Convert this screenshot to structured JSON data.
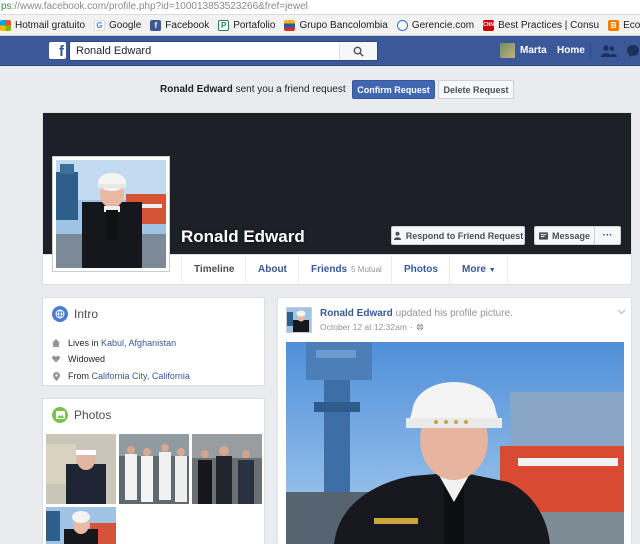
{
  "browser": {
    "url_scheme": "ps",
    "url_rest": "://www.facebook.com/profile.php?id=100013853523266&fref=jewel",
    "bookmarks": [
      {
        "label": "Hotmail gratuito",
        "icon": "windows-icon",
        "color": "#e94e2f"
      },
      {
        "label": "Google",
        "icon": "google-icon",
        "color": "#4285f4"
      },
      {
        "label": "Facebook",
        "icon": "facebook-icon",
        "color": "#3b5998"
      },
      {
        "label": "Portafolio",
        "icon": "p-icon",
        "color": "#2c7a5a"
      },
      {
        "label": "Grupo Bancolombia",
        "icon": "bancolombia-icon",
        "color": "#f2b50f"
      },
      {
        "label": "Gerencie.com",
        "icon": "gerencie-icon",
        "color": "#2a72c9"
      },
      {
        "label": "Best Practices | Consu",
        "icon": "cnn-icon",
        "color": "#cc0000"
      },
      {
        "label": "Economia Excel",
        "icon": "blogger-icon",
        "color": "#f57d00"
      },
      {
        "label": "",
        "icon": "page-icon",
        "color": "#888888"
      }
    ]
  },
  "fb_header": {
    "logo": "f",
    "search_value": "Ronald Edward",
    "user_name": "Marta",
    "home_label": "Home",
    "accent": "#3b5998"
  },
  "friend_request": {
    "sender": "Ronald Edward",
    "text": "sent you a friend request",
    "confirm_label": "Confirm Request",
    "delete_label": "Delete Request"
  },
  "profile": {
    "name": "Ronald Edward",
    "respond_label": "Respond to Friend Request",
    "message_label": "Message",
    "more_label": "···"
  },
  "tabs": [
    {
      "label": "Timeline",
      "sub": ""
    },
    {
      "label": "About",
      "sub": ""
    },
    {
      "label": "Friends",
      "sub": "5 Mutual"
    },
    {
      "label": "Photos",
      "sub": ""
    },
    {
      "label": "More",
      "sub": ""
    }
  ],
  "intro": {
    "title": "Intro",
    "lives_prefix": "Lives in",
    "lives_link": "Kabul, Afghanistan",
    "relationship": "Widowed",
    "from_prefix": "From",
    "from_link": "California City, California"
  },
  "photos": {
    "title": "Photos"
  },
  "post": {
    "author": "Ronald Edward",
    "action": "updated his profile picture.",
    "time": "October 12 at 12:32am",
    "audience_icon": "globe-icon"
  }
}
